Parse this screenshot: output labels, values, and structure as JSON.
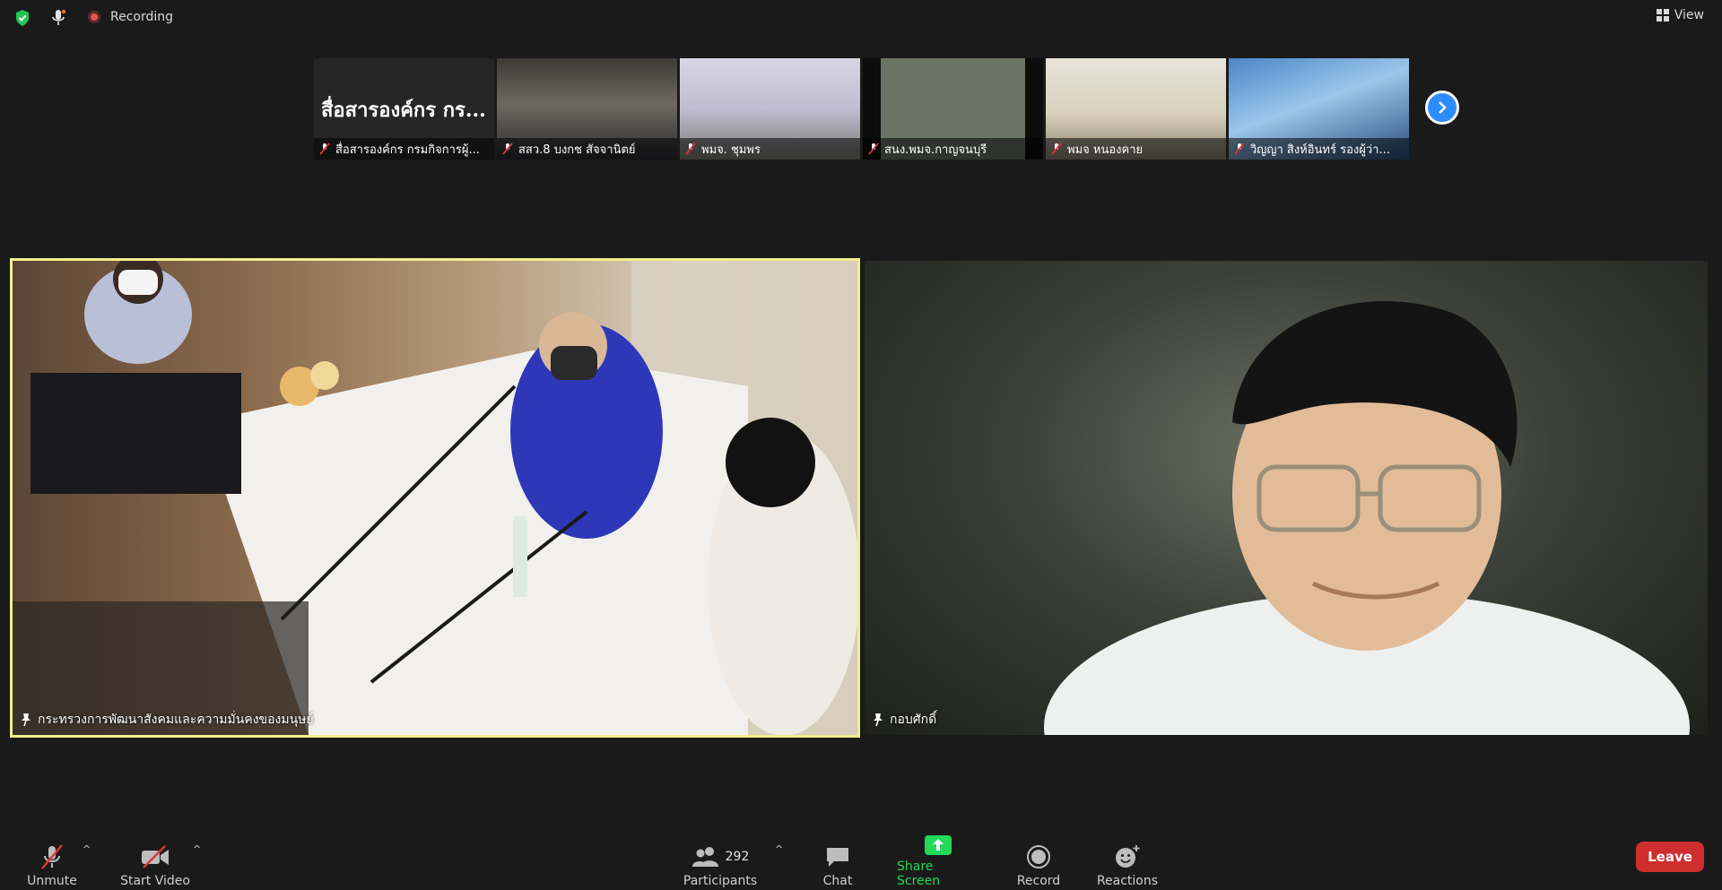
{
  "topbar": {
    "recording_label": "Recording",
    "view_label": "View"
  },
  "thumbnails": [
    {
      "name": "สื่อสารองค์กร กรมกิจการผู้...",
      "display_text": "สื่อสารองค์กร กร..."
    },
    {
      "name": "สสว.8 บงกช สัจจานิตย์"
    },
    {
      "name": "พมจ. ชุมพร"
    },
    {
      "name": "สนง.พมจ.กาญจนบุรี"
    },
    {
      "name": "พมจ หนองคาย"
    },
    {
      "name": "วิญญา  สิงห์อินทร์  รองผู้ว่า..."
    }
  ],
  "videos": {
    "left_name": "กระทรวงการพัฒนาสังคมและความมั่นคงของมนุษย์",
    "right_name": "กอบศักดิ์"
  },
  "toolbar": {
    "unmute_label": "Unmute",
    "start_video_label": "Start Video",
    "participants_label": "Participants",
    "participants_count": "292",
    "chat_label": "Chat",
    "share_label": "Share Screen",
    "record_label": "Record",
    "reactions_label": "Reactions",
    "leave_label": "Leave"
  },
  "colors": {
    "active_speaker_border": "#f0ee8c",
    "share_green": "#23d959",
    "leave_red": "#cf2e2e",
    "next_blue": "#2d8cff"
  }
}
